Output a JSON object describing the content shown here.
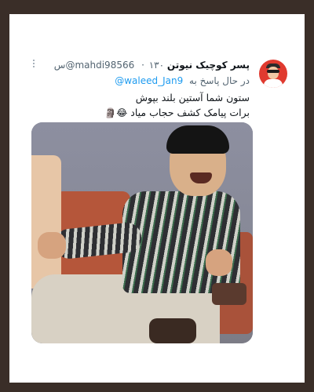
{
  "tweet": {
    "display_name": "پسر کوچیک نیوتن",
    "handle": "@mahdi98566",
    "time": "۱۳۰س",
    "separator": "·",
    "reply_prefix": "در حال پاسخ به",
    "reply_to": "@waleed_Jan9",
    "text_line_1": "ستون شما آستین بلند بپوش",
    "text_line_2": "برات پیامک کشف حجاب میاد",
    "text_emojis": "😂🗿",
    "more_icon": "more-options-icon",
    "avatar_icon": "user-avatar"
  },
  "colors": {
    "background_outer": "#3a2e28",
    "card": "#ffffff",
    "link": "#1d9bf0",
    "secondary_text": "#536471",
    "avatar_bg": "#e03a2f"
  }
}
